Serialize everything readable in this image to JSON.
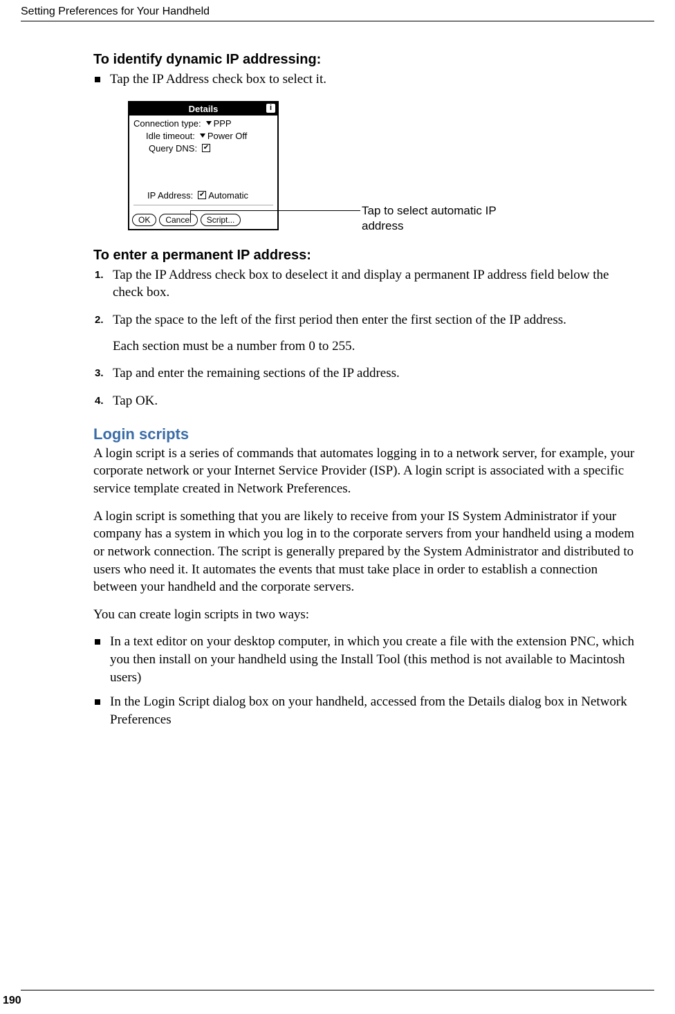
{
  "header": "Setting Preferences for Your Handheld",
  "page_number": "190",
  "subheading1": "To identify dynamic IP addressing:",
  "bullet1": "Tap the IP Address check box to select it.",
  "device": {
    "title": "Details",
    "conn_type_label": "Connection type:",
    "conn_type_value": "PPP",
    "idle_label": "Idle timeout:",
    "idle_value": "Power Off",
    "query_dns_label": "Query DNS:",
    "ip_label": "IP Address:",
    "ip_value": "Automatic",
    "ok": "OK",
    "cancel": "Cancel",
    "script": "Script..."
  },
  "callout_text": "Tap to select automatic IP address",
  "subheading2": "To enter a permanent IP address:",
  "steps": {
    "s1": "Tap the IP Address check box to deselect it and display a permanent IP address field below the check box.",
    "s2": "Tap the space to the left of the first period then enter the first section of the IP address.",
    "s2_note": "Each section must be a number from 0 to 255.",
    "s3": "Tap and enter the remaining sections of the IP address.",
    "s4": "Tap OK."
  },
  "section_heading": "Login scripts",
  "para1": "A login script is a series of commands that automates logging in to a network server, for example, your corporate network or your Internet Service Provider (ISP). A login script is associated with a specific service template created in Network Preferences.",
  "para2": "A login script is something that you are likely to receive from your IS System Administrator if your company has a system in which you log in to the corporate servers from your handheld using a modem or network connection. The script is generally prepared by the System Administrator and distributed to users who need it. It automates the events that must take place in order to establish a connection between your handheld and the corporate servers.",
  "para3": "You can create login scripts in two ways:",
  "bullet2": "In a text editor on your desktop computer, in which you create a file with the extension PNC, which you then install on your handheld using the Install Tool (this method is not available to Macintosh users)",
  "bullet3": "In the Login Script dialog box on your handheld, accessed from the Details dialog box in Network Preferences"
}
